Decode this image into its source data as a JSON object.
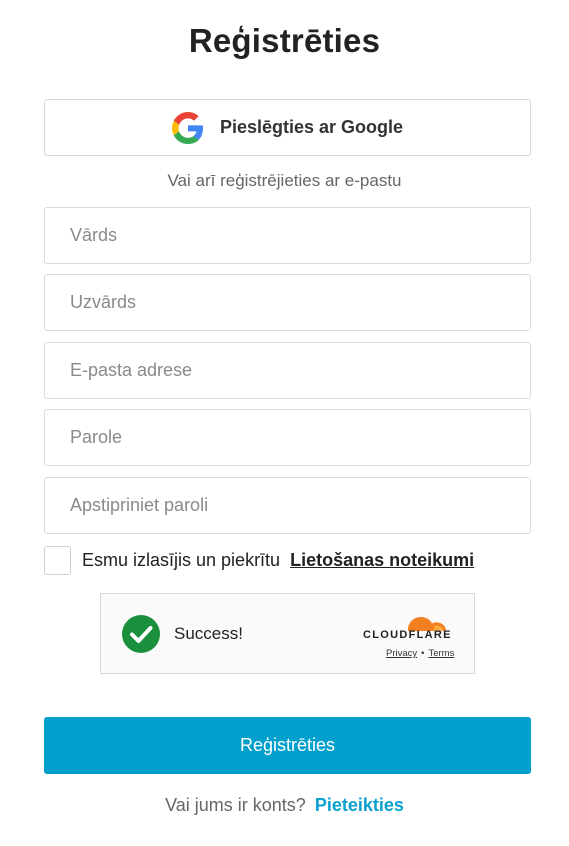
{
  "page": {
    "title": "Reģistrēties"
  },
  "google": {
    "label": "Pieslēgties ar Google",
    "icon": "google-icon"
  },
  "divider_text": "Vai arī reģistrējieties ar e-pastu",
  "form": {
    "first_name_placeholder": "Vārds",
    "last_name_placeholder": "Uzvārds",
    "email_placeholder": "E-pasta adrese",
    "password_placeholder": "Parole",
    "confirm_password_placeholder": "Apstipriniet paroli"
  },
  "terms": {
    "text": "Esmu izlasījis un piekrītu",
    "link": "Lietošanas noteikumi",
    "checked": false
  },
  "captcha": {
    "status": "Success!",
    "brand": "CLOUDFLARE",
    "privacy": "Privacy",
    "separator": "•",
    "terms": "Terms",
    "success_color": "#1a8f3c",
    "brand_color": "#f38020"
  },
  "submit": {
    "label": "Reģistrēties",
    "color": "#009fcc"
  },
  "login": {
    "question": "Vai jums ir konts?",
    "link": "Pieteikties"
  }
}
